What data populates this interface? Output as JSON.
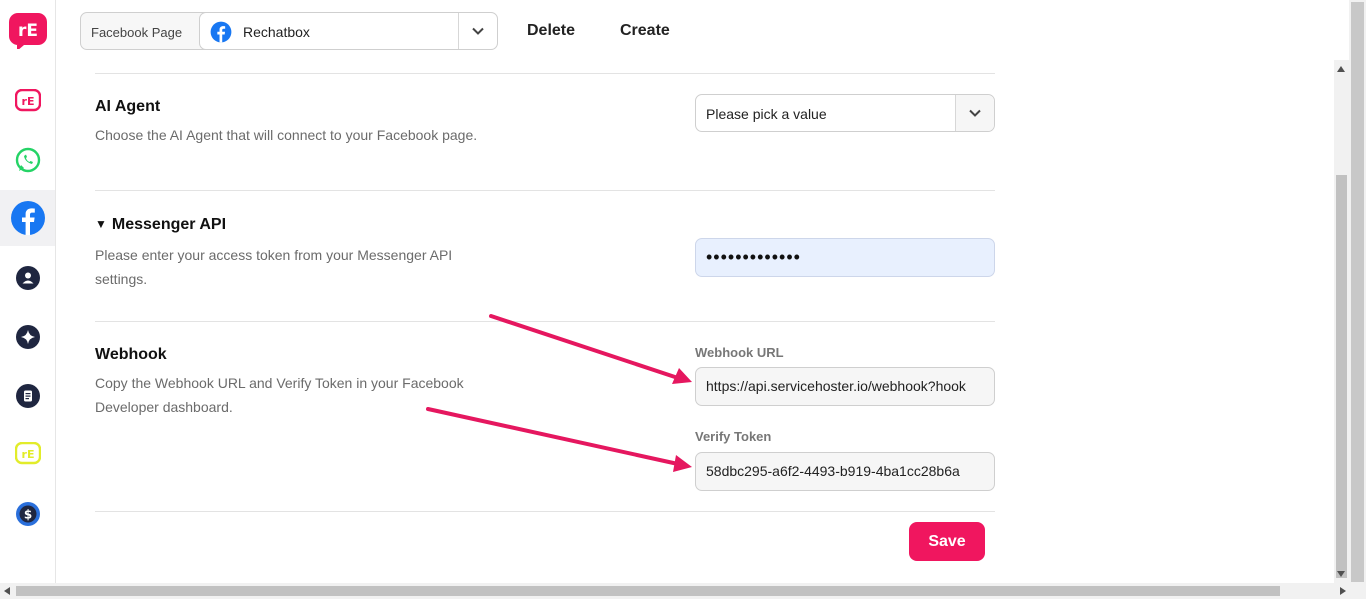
{
  "header": {
    "facebook_page_label": "Facebook Page",
    "selected_page": "Rechatbox",
    "delete_label": "Delete",
    "create_label": "Create"
  },
  "sidebar": {
    "items": [
      {
        "icon": "rechatbox-logo-icon",
        "active": false
      },
      {
        "icon": "whatsapp-icon",
        "active": false
      },
      {
        "icon": "facebook-icon",
        "active": true
      },
      {
        "icon": "contact-icon",
        "active": false
      },
      {
        "icon": "ai-sparkle-icon",
        "active": false
      },
      {
        "icon": "document-icon",
        "active": false
      },
      {
        "icon": "rechatbox-yellow-icon",
        "active": false
      },
      {
        "icon": "billing-dollar-icon",
        "active": false
      }
    ]
  },
  "ai_agent": {
    "title": "AI Agent",
    "description": "Choose the AI Agent that will connect to your Facebook page.",
    "placeholder": "Please pick a value"
  },
  "messenger_api": {
    "title": "Messenger API",
    "description": "Please enter your access token from your Messenger API settings.",
    "token_mask": "•••••••••••••"
  },
  "webhook": {
    "title": "Webhook",
    "description": "Copy the Webhook URL and Verify Token in your Facebook Developer dashboard.",
    "url_label": "Webhook URL",
    "url_value": "https://api.servicehoster.io/webhook?hook",
    "token_label": "Verify Token",
    "token_value": "58dbc295-a6f2-4493-b919-4ba1cc28b6a"
  },
  "actions": {
    "save_label": "Save"
  },
  "colors": {
    "brand": "#f0165f",
    "annotation_arrow": "#e5175f",
    "whatsapp": "#25d366",
    "facebook": "#1877f2",
    "input_autofill": "#e8f0fe"
  }
}
